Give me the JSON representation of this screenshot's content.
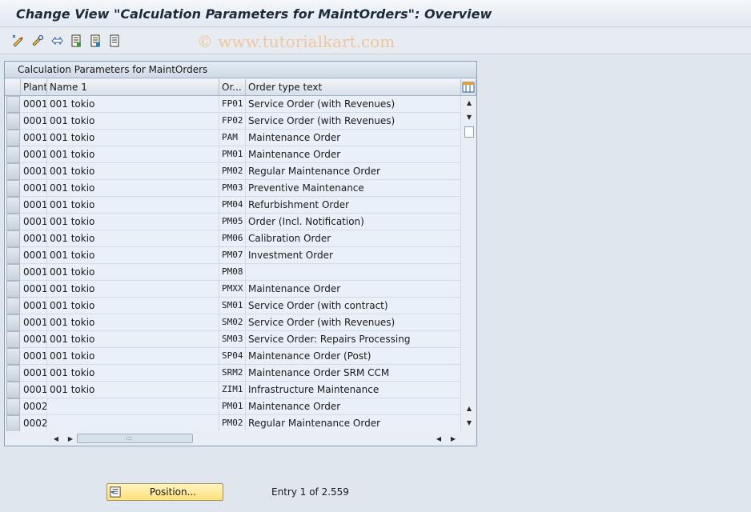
{
  "title": "Change View \"Calculation Parameters for MaintOrders\": Overview",
  "watermark": "© www.tutorialkart.com",
  "toolbar": {
    "icons": [
      "change-display-icon",
      "other-entries-icon",
      "refresh-icon",
      "save-list-icon",
      "select-all-icon",
      "deselect-icon"
    ]
  },
  "panel": {
    "caption": "Calculation Parameters for MaintOrders",
    "columns": {
      "plant": "Plant",
      "name": "Name 1",
      "order_type": "Or...",
      "order_text": "Order type text"
    },
    "rows": [
      {
        "plant": "0001",
        "name": "001 tokio",
        "order_type": "FP01",
        "order_text": "Service Order (with Revenues)"
      },
      {
        "plant": "0001",
        "name": "001 tokio",
        "order_type": "FP02",
        "order_text": "Service Order (with Revenues)"
      },
      {
        "plant": "0001",
        "name": "001 tokio",
        "order_type": "PAM",
        "order_text": "Maintenance Order"
      },
      {
        "plant": "0001",
        "name": "001 tokio",
        "order_type": "PM01",
        "order_text": "Maintenance Order"
      },
      {
        "plant": "0001",
        "name": "001 tokio",
        "order_type": "PM02",
        "order_text": "Regular Maintenance Order"
      },
      {
        "plant": "0001",
        "name": "001 tokio",
        "order_type": "PM03",
        "order_text": "Preventive Maintenance"
      },
      {
        "plant": "0001",
        "name": "001 tokio",
        "order_type": "PM04",
        "order_text": "Refurbishment Order"
      },
      {
        "plant": "0001",
        "name": "001 tokio",
        "order_type": "PM05",
        "order_text": "Order (Incl. Notification)"
      },
      {
        "plant": "0001",
        "name": "001 tokio",
        "order_type": "PM06",
        "order_text": "Calibration Order"
      },
      {
        "plant": "0001",
        "name": "001 tokio",
        "order_type": "PM07",
        "order_text": "Investment Order"
      },
      {
        "plant": "0001",
        "name": "001 tokio",
        "order_type": "PM08",
        "order_text": ""
      },
      {
        "plant": "0001",
        "name": "001 tokio",
        "order_type": "PMXX",
        "order_text": "Maintenance Order"
      },
      {
        "plant": "0001",
        "name": "001 tokio",
        "order_type": "SM01",
        "order_text": "Service Order (with contract)"
      },
      {
        "plant": "0001",
        "name": "001 tokio",
        "order_type": "SM02",
        "order_text": "Service Order (with Revenues)"
      },
      {
        "plant": "0001",
        "name": "001 tokio",
        "order_type": "SM03",
        "order_text": "Service Order: Repairs Processing"
      },
      {
        "plant": "0001",
        "name": "001 tokio",
        "order_type": "SP04",
        "order_text": "Maintenance Order (Post)"
      },
      {
        "plant": "0001",
        "name": "001 tokio",
        "order_type": "SRM2",
        "order_text": "Maintenance Order SRM CCM"
      },
      {
        "plant": "0001",
        "name": "001 tokio",
        "order_type": "ZIM1",
        "order_text": "Infrastructure Maintenance"
      },
      {
        "plant": "0002",
        "name": "",
        "order_type": "PM01",
        "order_text": "Maintenance Order"
      },
      {
        "plant": "0002",
        "name": "",
        "order_type": "PM02",
        "order_text": "Regular Maintenance Order"
      }
    ]
  },
  "footer": {
    "position_label": "Position...",
    "entry_text": "Entry 1 of 2.559"
  }
}
